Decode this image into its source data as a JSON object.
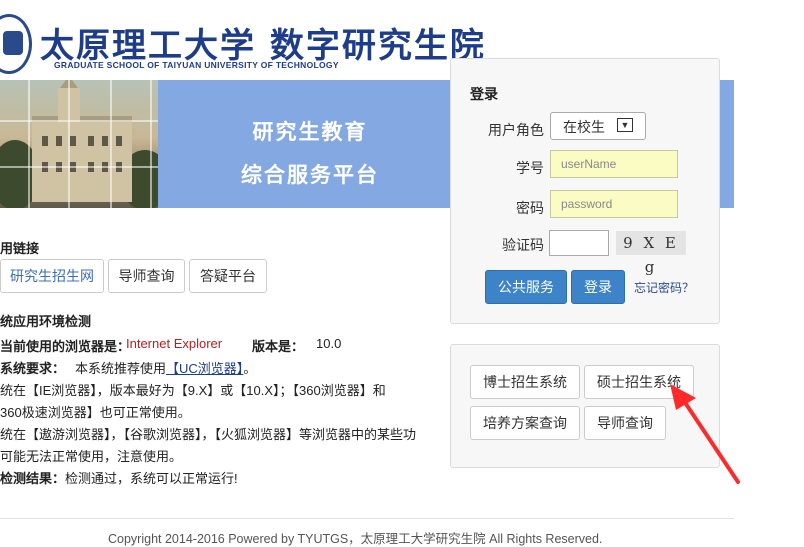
{
  "header": {
    "title_cn": "太原理工大学 数字研究生院",
    "title_en": "GRADUATE SCHOOL OF TAIYUAN UNIVERSITY OF TECHNOLOGY"
  },
  "banner": {
    "line1": "研究生教育",
    "line2": "综合服务平台"
  },
  "login": {
    "title": "登录",
    "role_label": "用户角色",
    "role_value": "在校生",
    "user_label": "学号",
    "user_placeholder": "userName",
    "pass_label": "密码",
    "pass_placeholder": "password",
    "captcha_label": "验证码",
    "captcha_text": "9 X E g",
    "public_button": "公共服务",
    "login_button": "登录",
    "forgot_link": "忘记密码？"
  },
  "links": {
    "heading": "用链接",
    "items": [
      "研究生招生网",
      "导师查询",
      "答疑平台"
    ]
  },
  "env": {
    "heading": "统应用环境检测",
    "browser_label": "当前使用的浏览器是：",
    "browser_value": "Internet Explorer",
    "version_label": "版本是：",
    "version_value": "10.0",
    "req_label": "系统要求：",
    "req_text": "本系统推荐使用",
    "req_link": "【UC浏览器】",
    "req_end": "。",
    "line3": "统在【IE浏览器】，版本最好为【9.X】或【10.X】；【360浏览器】和",
    "line4": "360极速浏览器】也可正常使用。",
    "line5": "统在【遨游浏览器】，【谷歌浏览器】，【火狐浏览器】等浏览器中的某些功",
    "line6": "可能无法正常使用，注意使用。",
    "result_label": "检测结果：",
    "result_text": "检测通过，系统可以正常运行!"
  },
  "systems": {
    "items": [
      "博士招生系统",
      "硕士招生系统",
      "培养方案查询",
      "导师查询"
    ]
  },
  "footer": {
    "text": "Copyright 2014-2016 Powered by TYUTGS，太原理工大学研究生院 All Rights Reserved."
  },
  "colors": {
    "banner": "#84a8e2",
    "primary_button": "#3d83c8",
    "input_bg": "#fbfbc4",
    "title_blue": "#1d3c8a",
    "arrow_red": "#ff2a2a"
  }
}
